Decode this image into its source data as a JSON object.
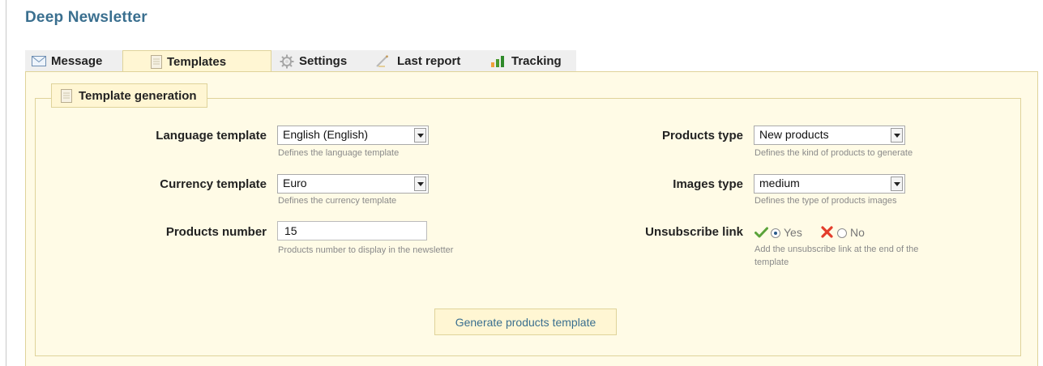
{
  "page": {
    "title": "Deep Newsletter"
  },
  "tabs": [
    {
      "label": "Message",
      "icon": "envelope-icon"
    },
    {
      "label": "Templates",
      "icon": "document-icon",
      "active": true
    },
    {
      "label": "Settings",
      "icon": "gear-icon"
    },
    {
      "label": "Last report",
      "icon": "pencil-icon"
    },
    {
      "label": "Tracking",
      "icon": "bar-chart-icon"
    }
  ],
  "section": {
    "title": "Template generation",
    "icon": "document-icon"
  },
  "left_fields": {
    "language": {
      "label": "Language template",
      "value": "English (English)",
      "hint": "Defines the language template"
    },
    "currency": {
      "label": "Currency template",
      "value": "Euro",
      "hint": "Defines the currency template"
    },
    "products_number": {
      "label": "Products number",
      "value": "15",
      "hint": "Products number to display in the newsletter"
    }
  },
  "right_fields": {
    "products_type": {
      "label": "Products type",
      "value": "New products",
      "hint": "Defines the kind of products to generate"
    },
    "images_type": {
      "label": "Images type",
      "value": "medium",
      "hint": "Defines the type of products images"
    },
    "unsubscribe": {
      "label": "Unsubscribe link",
      "yes_label": "Yes",
      "no_label": "No",
      "selected": "Yes",
      "hint_line1": "Add the unsubscribe link at the end of the",
      "hint_line2": "template"
    }
  },
  "actions": {
    "generate_label": "Generate products template"
  },
  "colors": {
    "title": "#3a6f8f",
    "panel_bg": "#fffbe6",
    "panel_border": "#dfd39a",
    "tab_bg": "#efefef",
    "active_tab_bg": "#fff6d3"
  }
}
